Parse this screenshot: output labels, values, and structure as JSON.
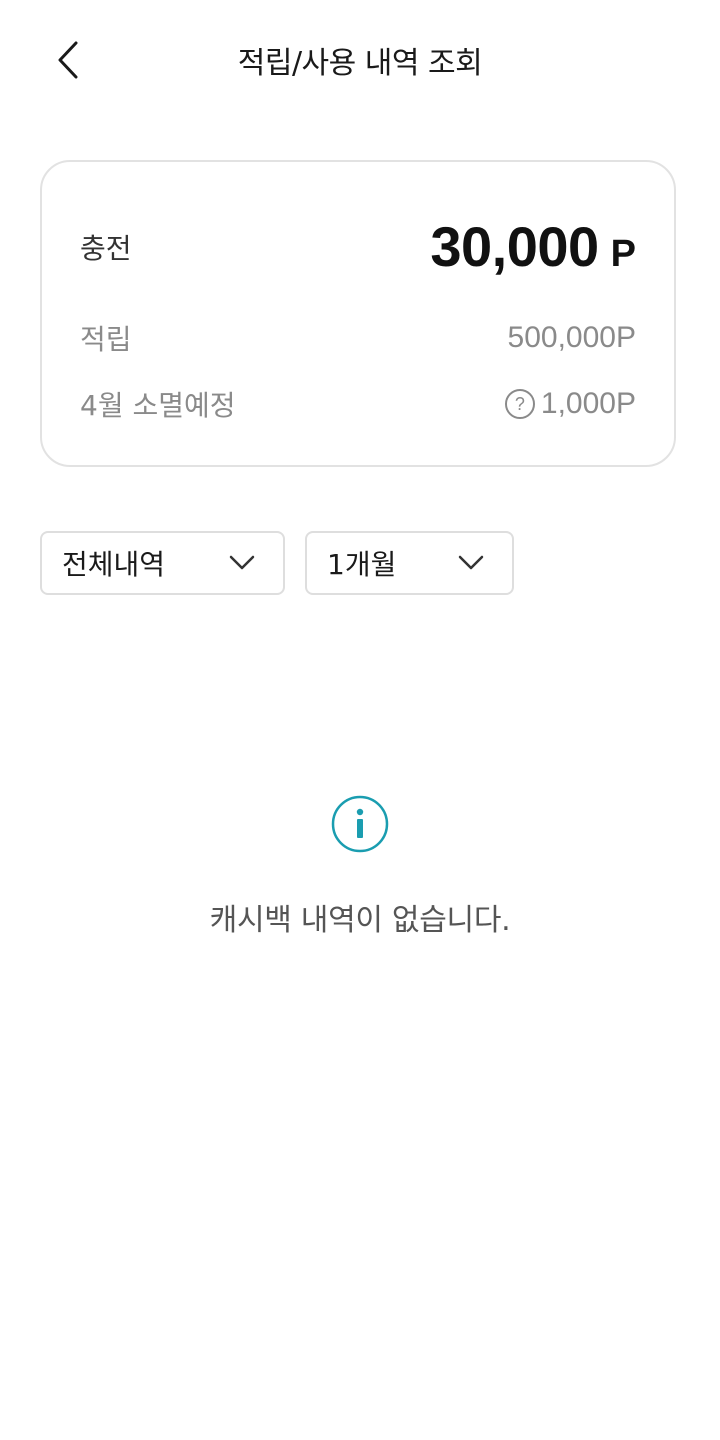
{
  "header": {
    "title": "적립/사용 내역 조회",
    "back_icon": "chevron-left-icon"
  },
  "summary": {
    "charge_label": "충전",
    "charge_amount": "30,000",
    "charge_unit": "P",
    "accum_label": "적립",
    "accum_value": "500,000P",
    "expire_label": "4월 소멸예정",
    "expire_help_glyph": "?",
    "expire_value": "1,000P"
  },
  "filters": {
    "type_selected": "전체내역",
    "period_selected": "1개월"
  },
  "empty": {
    "icon": "info-icon",
    "message": "캐시백 내역이 없습니다."
  },
  "colors": {
    "accent": "#1a9db0",
    "border": "#e2e2e2",
    "muted_text": "#8a8a8a"
  }
}
